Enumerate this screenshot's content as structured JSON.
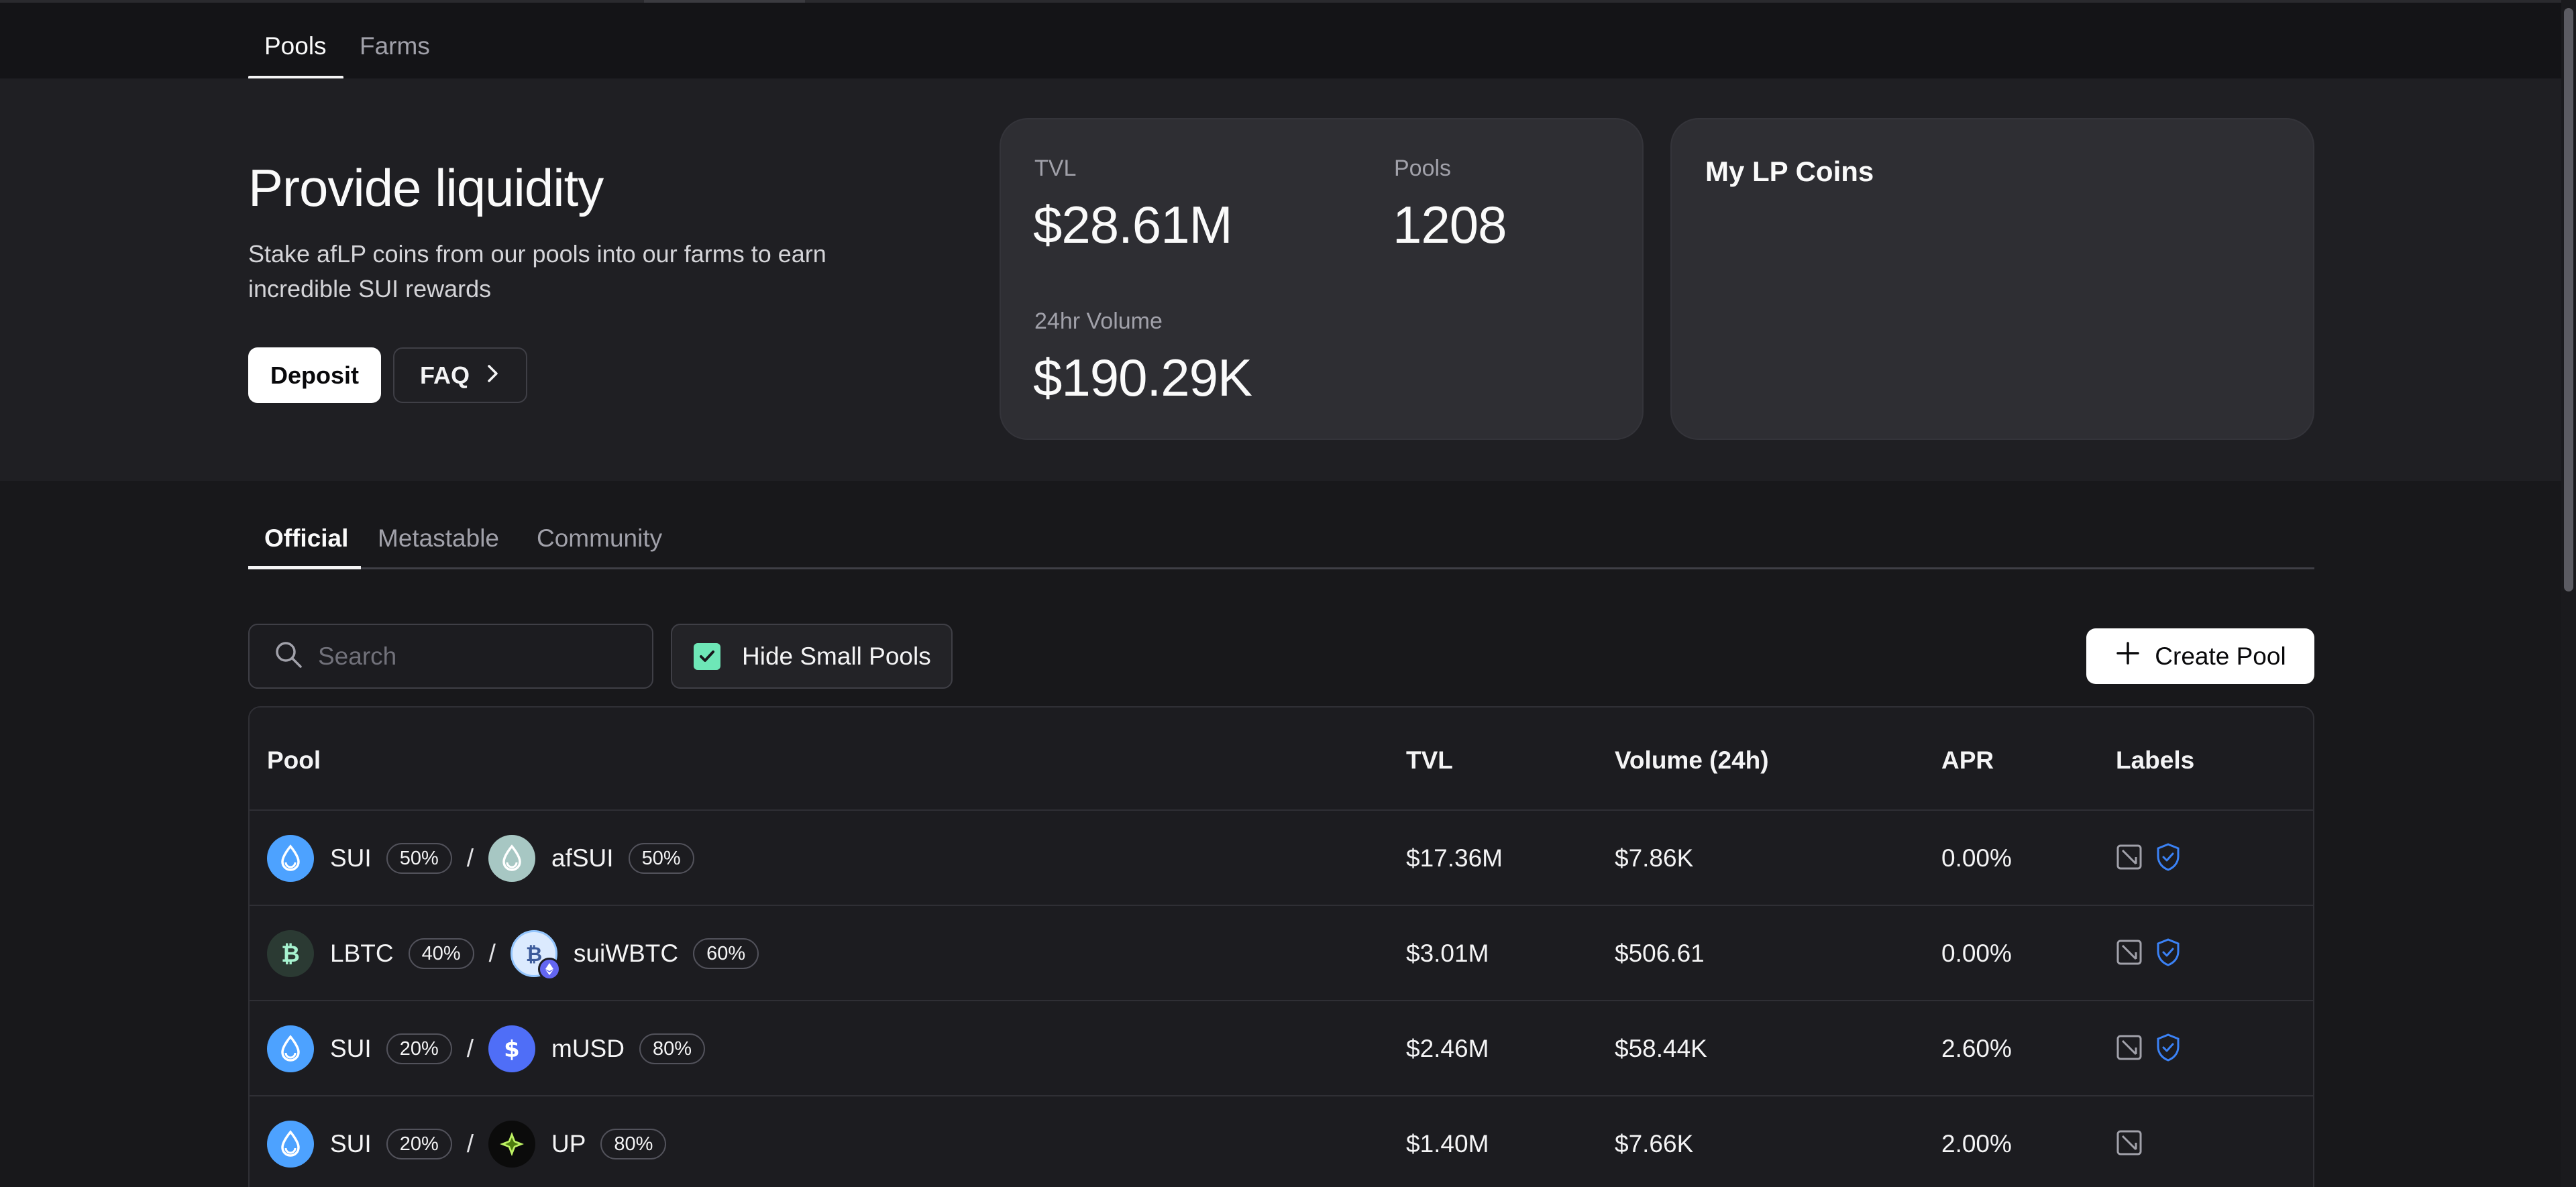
{
  "top_tabs": [
    {
      "label": "Pools",
      "active": true
    },
    {
      "label": "Farms",
      "active": false
    }
  ],
  "hero": {
    "title": "Provide liquidity",
    "description": "Stake afLP coins from our pools into our farms to earn incredible SUI rewards",
    "deposit_label": "Deposit",
    "faq_label": "FAQ"
  },
  "stats": {
    "tvl_label": "TVL",
    "tvl_value": "$28.61M",
    "pools_label": "Pools",
    "pools_value": "1208",
    "volume_label": "24hr Volume",
    "volume_value": "$190.29K"
  },
  "lp_card": {
    "title": "My LP Coins"
  },
  "category_tabs": [
    {
      "label": "Official",
      "active": true
    },
    {
      "label": "Metastable",
      "active": false
    },
    {
      "label": "Community",
      "active": false
    }
  ],
  "toolbar": {
    "search_placeholder": "Search",
    "hide_small_label": "Hide Small Pools",
    "hide_small_checked": true,
    "create_label": "Create Pool"
  },
  "table": {
    "headers": {
      "pool": "Pool",
      "tvl": "TVL",
      "volume": "Volume (24h)",
      "apr": "APR",
      "labels": "Labels"
    },
    "rows": [
      {
        "coin_a": "SUI",
        "weight_a": "50%",
        "coin_b": "afSUI",
        "weight_b": "50%",
        "tvl": "$17.36M",
        "volume": "$7.86K",
        "apr": "0.00%",
        "verified": true
      },
      {
        "coin_a": "LBTC",
        "weight_a": "40%",
        "coin_b": "suiWBTC",
        "weight_b": "60%",
        "tvl": "$3.01M",
        "volume": "$506.61",
        "apr": "0.00%",
        "verified": true
      },
      {
        "coin_a": "SUI",
        "weight_a": "20%",
        "coin_b": "mUSD",
        "weight_b": "80%",
        "tvl": "$2.46M",
        "volume": "$58.44K",
        "apr": "2.60%",
        "verified": true
      },
      {
        "coin_a": "SUI",
        "weight_a": "20%",
        "coin_b": "UP",
        "weight_b": "80%",
        "tvl": "$1.40M",
        "volume": "$7.66K",
        "apr": "2.00%",
        "verified": false
      }
    ]
  },
  "colors": {
    "accent_check": "#6ee7b7",
    "sui_blue": "#4da2ff",
    "shield_blue": "#3b82f6"
  }
}
